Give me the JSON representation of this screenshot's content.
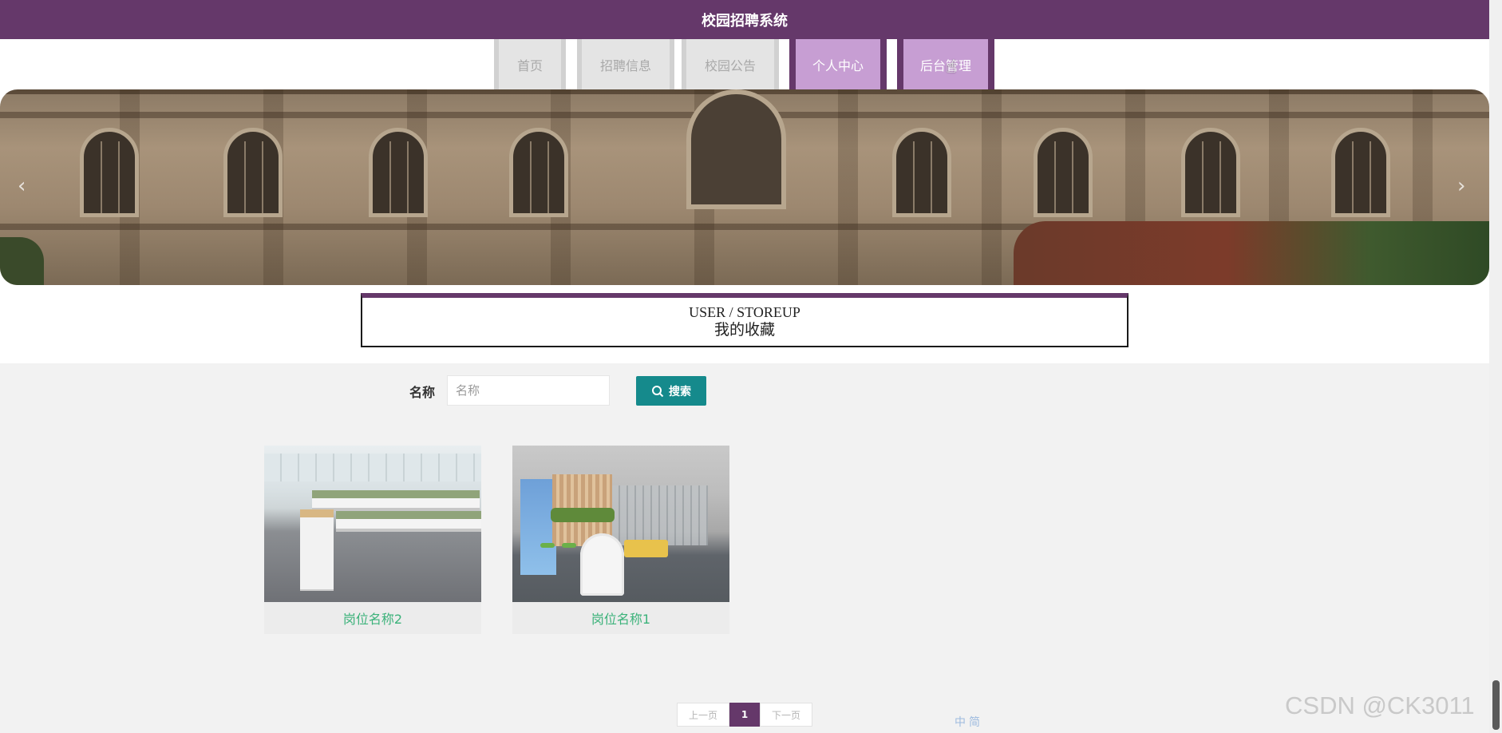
{
  "app": {
    "title": "校园招聘系统"
  },
  "nav": {
    "items": [
      {
        "label": "首页"
      },
      {
        "label": "招聘信息"
      },
      {
        "label": "校园公告"
      },
      {
        "label": "个人中心"
      },
      {
        "label": "后台管理"
      }
    ]
  },
  "page_header": {
    "title_en": "USER / STOREUP",
    "title_cn": "我的收藏"
  },
  "search": {
    "label": "名称",
    "placeholder": "名称",
    "value": "",
    "button_label": "搜索",
    "button_icon": "search-icon"
  },
  "cards": [
    {
      "name": "岗位名称2"
    },
    {
      "name": "岗位名称1"
    }
  ],
  "pagination": {
    "prev_label": "上一页",
    "current": "1",
    "next_label": "下一页"
  },
  "watermark": "CSDN @CK3011",
  "ime_bar": [
    "中",
    "简"
  ],
  "colors": {
    "brand": "#65386a",
    "nav_active": "#c79ed3",
    "search_button": "#158a8c",
    "card_title": "#3bb27a"
  }
}
